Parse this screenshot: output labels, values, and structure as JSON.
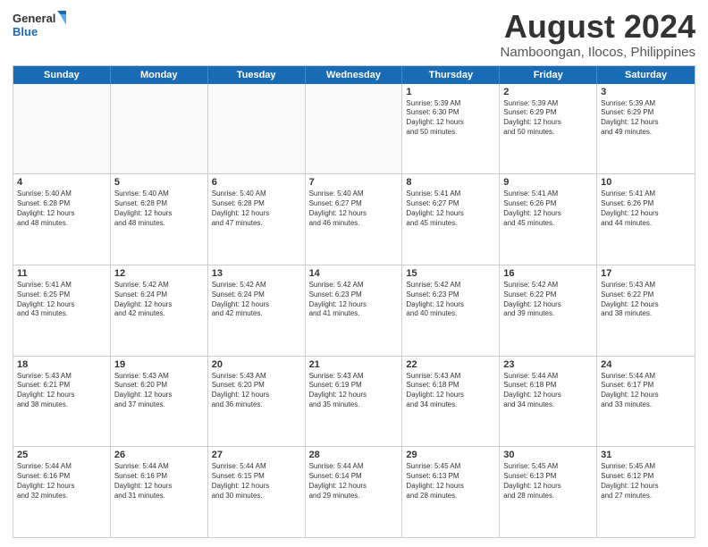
{
  "logo": {
    "line1": "General",
    "line2": "Blue"
  },
  "title": "August 2024",
  "subtitle": "Namboongan, Ilocos, Philippines",
  "headers": [
    "Sunday",
    "Monday",
    "Tuesday",
    "Wednesday",
    "Thursday",
    "Friday",
    "Saturday"
  ],
  "rows": [
    [
      {
        "day": "",
        "text": "",
        "empty": true
      },
      {
        "day": "",
        "text": "",
        "empty": true
      },
      {
        "day": "",
        "text": "",
        "empty": true
      },
      {
        "day": "",
        "text": "",
        "empty": true
      },
      {
        "day": "1",
        "text": "Sunrise: 5:39 AM\nSunset: 6:30 PM\nDaylight: 12 hours\nand 50 minutes."
      },
      {
        "day": "2",
        "text": "Sunrise: 5:39 AM\nSunset: 6:29 PM\nDaylight: 12 hours\nand 50 minutes."
      },
      {
        "day": "3",
        "text": "Sunrise: 5:39 AM\nSunset: 6:29 PM\nDaylight: 12 hours\nand 49 minutes."
      }
    ],
    [
      {
        "day": "4",
        "text": "Sunrise: 5:40 AM\nSunset: 6:28 PM\nDaylight: 12 hours\nand 48 minutes."
      },
      {
        "day": "5",
        "text": "Sunrise: 5:40 AM\nSunset: 6:28 PM\nDaylight: 12 hours\nand 48 minutes."
      },
      {
        "day": "6",
        "text": "Sunrise: 5:40 AM\nSunset: 6:28 PM\nDaylight: 12 hours\nand 47 minutes."
      },
      {
        "day": "7",
        "text": "Sunrise: 5:40 AM\nSunset: 6:27 PM\nDaylight: 12 hours\nand 46 minutes."
      },
      {
        "day": "8",
        "text": "Sunrise: 5:41 AM\nSunset: 6:27 PM\nDaylight: 12 hours\nand 45 minutes."
      },
      {
        "day": "9",
        "text": "Sunrise: 5:41 AM\nSunset: 6:26 PM\nDaylight: 12 hours\nand 45 minutes."
      },
      {
        "day": "10",
        "text": "Sunrise: 5:41 AM\nSunset: 6:26 PM\nDaylight: 12 hours\nand 44 minutes."
      }
    ],
    [
      {
        "day": "11",
        "text": "Sunrise: 5:41 AM\nSunset: 6:25 PM\nDaylight: 12 hours\nand 43 minutes."
      },
      {
        "day": "12",
        "text": "Sunrise: 5:42 AM\nSunset: 6:24 PM\nDaylight: 12 hours\nand 42 minutes."
      },
      {
        "day": "13",
        "text": "Sunrise: 5:42 AM\nSunset: 6:24 PM\nDaylight: 12 hours\nand 42 minutes."
      },
      {
        "day": "14",
        "text": "Sunrise: 5:42 AM\nSunset: 6:23 PM\nDaylight: 12 hours\nand 41 minutes."
      },
      {
        "day": "15",
        "text": "Sunrise: 5:42 AM\nSunset: 6:23 PM\nDaylight: 12 hours\nand 40 minutes."
      },
      {
        "day": "16",
        "text": "Sunrise: 5:42 AM\nSunset: 6:22 PM\nDaylight: 12 hours\nand 39 minutes."
      },
      {
        "day": "17",
        "text": "Sunrise: 5:43 AM\nSunset: 6:22 PM\nDaylight: 12 hours\nand 38 minutes."
      }
    ],
    [
      {
        "day": "18",
        "text": "Sunrise: 5:43 AM\nSunset: 6:21 PM\nDaylight: 12 hours\nand 38 minutes."
      },
      {
        "day": "19",
        "text": "Sunrise: 5:43 AM\nSunset: 6:20 PM\nDaylight: 12 hours\nand 37 minutes."
      },
      {
        "day": "20",
        "text": "Sunrise: 5:43 AM\nSunset: 6:20 PM\nDaylight: 12 hours\nand 36 minutes."
      },
      {
        "day": "21",
        "text": "Sunrise: 5:43 AM\nSunset: 6:19 PM\nDaylight: 12 hours\nand 35 minutes."
      },
      {
        "day": "22",
        "text": "Sunrise: 5:43 AM\nSunset: 6:18 PM\nDaylight: 12 hours\nand 34 minutes."
      },
      {
        "day": "23",
        "text": "Sunrise: 5:44 AM\nSunset: 6:18 PM\nDaylight: 12 hours\nand 34 minutes."
      },
      {
        "day": "24",
        "text": "Sunrise: 5:44 AM\nSunset: 6:17 PM\nDaylight: 12 hours\nand 33 minutes."
      }
    ],
    [
      {
        "day": "25",
        "text": "Sunrise: 5:44 AM\nSunset: 6:16 PM\nDaylight: 12 hours\nand 32 minutes."
      },
      {
        "day": "26",
        "text": "Sunrise: 5:44 AM\nSunset: 6:16 PM\nDaylight: 12 hours\nand 31 minutes."
      },
      {
        "day": "27",
        "text": "Sunrise: 5:44 AM\nSunset: 6:15 PM\nDaylight: 12 hours\nand 30 minutes."
      },
      {
        "day": "28",
        "text": "Sunrise: 5:44 AM\nSunset: 6:14 PM\nDaylight: 12 hours\nand 29 minutes."
      },
      {
        "day": "29",
        "text": "Sunrise: 5:45 AM\nSunset: 6:13 PM\nDaylight: 12 hours\nand 28 minutes."
      },
      {
        "day": "30",
        "text": "Sunrise: 5:45 AM\nSunset: 6:13 PM\nDaylight: 12 hours\nand 28 minutes."
      },
      {
        "day": "31",
        "text": "Sunrise: 5:45 AM\nSunset: 6:12 PM\nDaylight: 12 hours\nand 27 minutes."
      }
    ]
  ]
}
